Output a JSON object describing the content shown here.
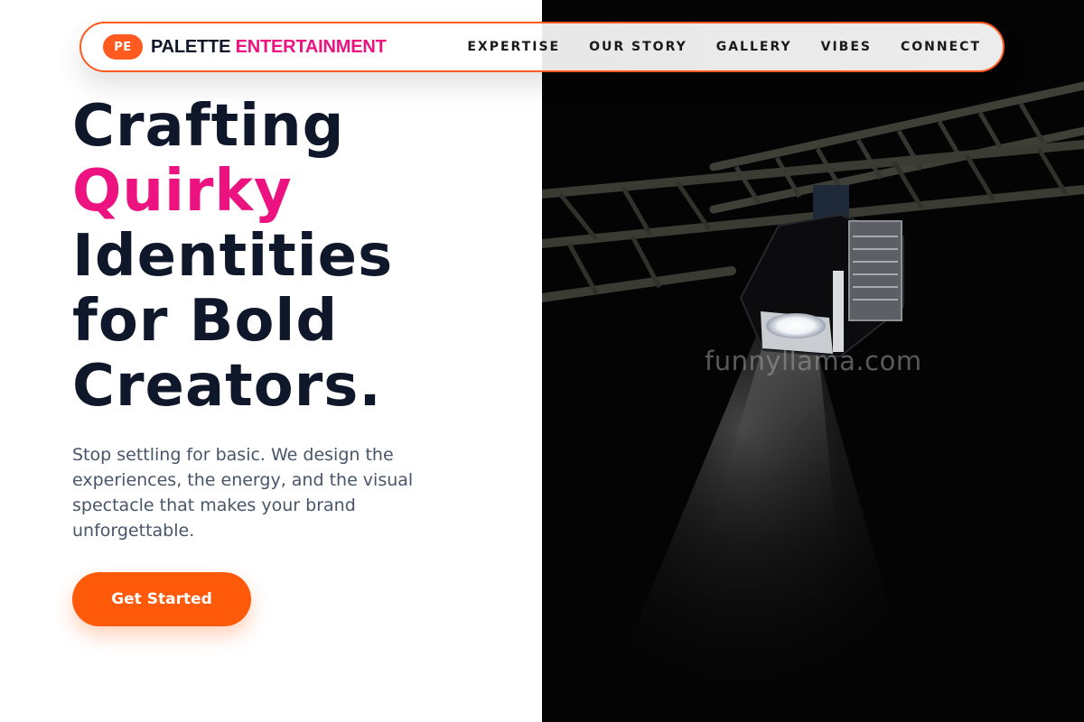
{
  "brand": {
    "badge": "PE",
    "name_primary": "PALETTE",
    "name_accent": "ENTERTAINMENT"
  },
  "nav": {
    "items": [
      {
        "label": "EXPERTISE"
      },
      {
        "label": "OUR STORY"
      },
      {
        "label": "GALLERY"
      },
      {
        "label": "VIBES"
      },
      {
        "label": "CONNECT"
      }
    ]
  },
  "hero": {
    "headline_lines": [
      "Crafting",
      "Quirky",
      "Identities",
      "for Bold",
      "Creators."
    ],
    "subtext": "Stop settling for basic. We design the experiences, the energy, and the visual spectacle that makes your brand unforgettable.",
    "cta_label": "Get Started"
  },
  "image": {
    "watermark": "funnyllama.com",
    "icon": "stage-spotlight-photo"
  },
  "colors": {
    "accent_orange": "#ff5a1f",
    "accent_pink": "#ec1380",
    "text_dark": "#0f172a",
    "text_muted": "#475569"
  }
}
